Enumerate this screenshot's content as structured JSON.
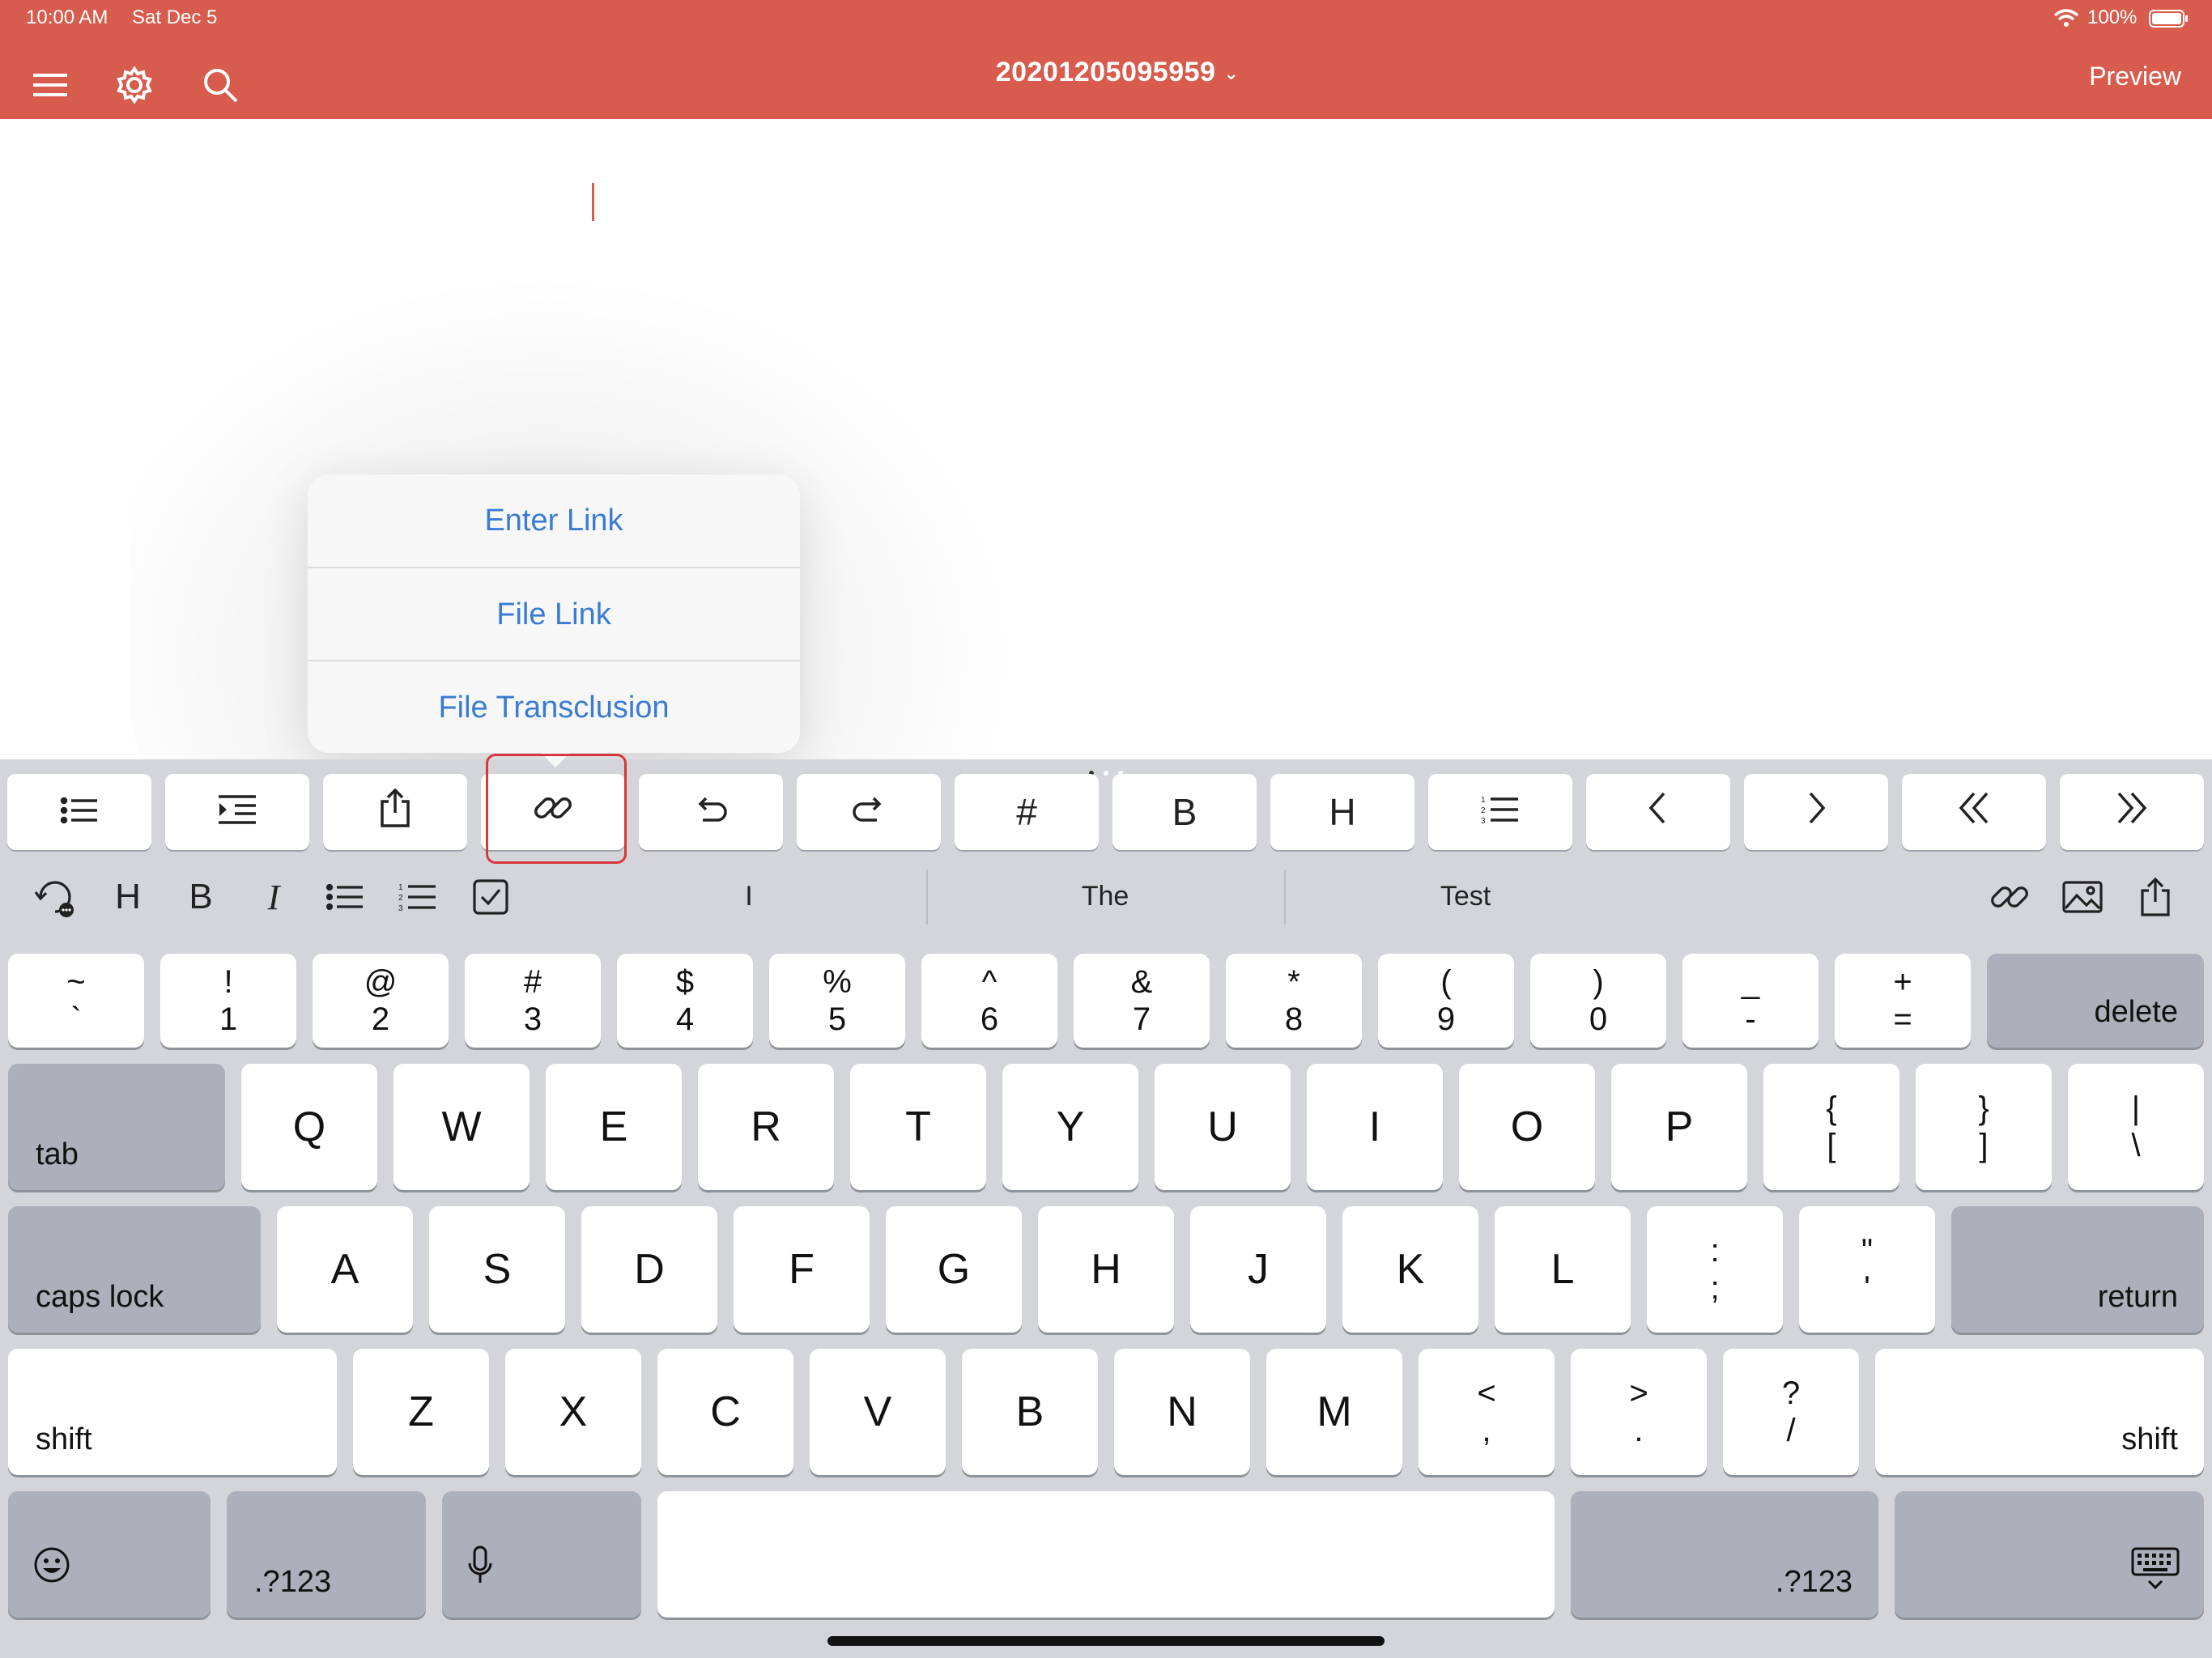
{
  "status_bar": {
    "time": "10:00 AM",
    "date": "Sat Dec 5",
    "battery": "100%"
  },
  "header": {
    "title": "20201205095959",
    "preview": "Preview"
  },
  "popup": {
    "items": [
      "Enter Link",
      "File Link",
      "File Transclusion"
    ]
  },
  "toolbar": {
    "hash": "#",
    "bold": "B",
    "heading": "H"
  },
  "shortcut_bar": {
    "heading": "H",
    "bold": "B",
    "italic": "I"
  },
  "suggestions": [
    "I",
    "The",
    "Test"
  ],
  "keys": {
    "row1": [
      [
        "~",
        "`"
      ],
      [
        "!",
        "1"
      ],
      [
        "@",
        "2"
      ],
      [
        "#",
        "3"
      ],
      [
        "$",
        "4"
      ],
      [
        "%",
        "5"
      ],
      [
        "^",
        "6"
      ],
      [
        "&",
        "7"
      ],
      [
        "*",
        "8"
      ],
      [
        "(",
        "9"
      ],
      [
        ")",
        "0"
      ],
      [
        "_",
        "-"
      ],
      [
        "+",
        "="
      ]
    ],
    "delete": "delete",
    "tab": "tab",
    "row2": [
      "Q",
      "W",
      "E",
      "R",
      "T",
      "Y",
      "U",
      "I",
      "O",
      "P"
    ],
    "row2_sym": [
      [
        "{",
        "["
      ],
      [
        "}",
        "]"
      ],
      [
        "|",
        "\\"
      ]
    ],
    "caps": "caps lock",
    "row3": [
      "A",
      "S",
      "D",
      "F",
      "G",
      "H",
      "J",
      "K",
      "L"
    ],
    "row3_sym": [
      [
        ":",
        ";"
      ],
      [
        "\"",
        "'"
      ]
    ],
    "return": "return",
    "shift": "shift",
    "row4": [
      "Z",
      "X",
      "C",
      "V",
      "B",
      "N",
      "M"
    ],
    "row4_sym": [
      [
        "<",
        ","
      ],
      [
        ">",
        "."
      ],
      [
        "?",
        "/"
      ]
    ],
    "num": ".?123"
  },
  "colors": {
    "header": "#d85c4d",
    "link": "#3a7bd5",
    "highlight": "#d9363e"
  }
}
